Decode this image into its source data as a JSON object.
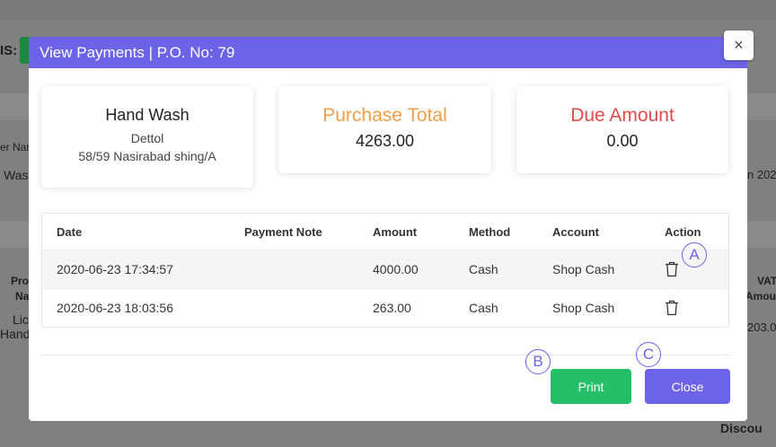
{
  "background": {
    "status_label": "IS:",
    "col_left_partial": "er Nar",
    "row_left_partial": "Was",
    "product_label_1": "Pro",
    "product_label_2": "Na",
    "product_value_1": "Lic",
    "product_value_2": "Hand",
    "right_date_partial": "n 202",
    "vat_label_1": "VAT",
    "vat_label_2": "Amou",
    "vat_value": "203.0",
    "discount_label": "Discou"
  },
  "modal": {
    "title": "View Payments | P.O. No: 79",
    "close_glyph": "×",
    "product_card": {
      "name": "Hand Wash",
      "brand": "Dettol",
      "address": "58/59 Nasirabad shing/A"
    },
    "purchase_card": {
      "label": "Purchase Total",
      "value": "4263.00"
    },
    "due_card": {
      "label": "Due Amount",
      "value": "0.00"
    },
    "table": {
      "headers": [
        "Date",
        "Payment Note",
        "Amount",
        "Method",
        "Account",
        "Action"
      ],
      "rows": [
        {
          "date": "2020-06-23 17:34:57",
          "note": "",
          "amount": "4000.00",
          "method": "Cash",
          "account": "Shop Cash",
          "action_icon": "trash-icon"
        },
        {
          "date": "2020-06-23 18:03:56",
          "note": "",
          "amount": "263.00",
          "method": "Cash",
          "account": "Shop Cash",
          "action_icon": "trash-icon"
        }
      ]
    },
    "buttons": {
      "print": "Print",
      "close": "Close"
    }
  },
  "markers": {
    "a": "A",
    "b": "B",
    "c": "C"
  },
  "colors": {
    "accent": "#6c63e6",
    "print_green": "#24bf68",
    "purchase_orange": "#f0a04a",
    "due_red": "#e04b4b"
  }
}
